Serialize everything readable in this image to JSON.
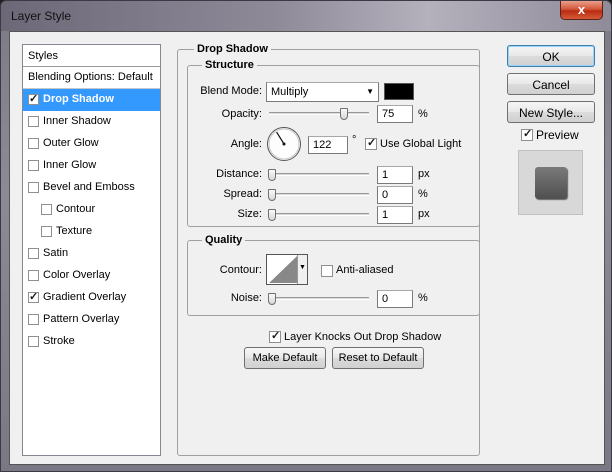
{
  "window": {
    "title": "Layer Style",
    "close_glyph": "x"
  },
  "styles_list": {
    "header": "Styles",
    "blending": "Blending Options: Default",
    "items": [
      {
        "label": "Drop Shadow",
        "checked": true,
        "selected": true,
        "indent": false
      },
      {
        "label": "Inner Shadow",
        "checked": false,
        "selected": false,
        "indent": false
      },
      {
        "label": "Outer Glow",
        "checked": false,
        "selected": false,
        "indent": false
      },
      {
        "label": "Inner Glow",
        "checked": false,
        "selected": false,
        "indent": false
      },
      {
        "label": "Bevel and Emboss",
        "checked": false,
        "selected": false,
        "indent": false
      },
      {
        "label": "Contour",
        "checked": false,
        "selected": false,
        "indent": true
      },
      {
        "label": "Texture",
        "checked": false,
        "selected": false,
        "indent": true
      },
      {
        "label": "Satin",
        "checked": false,
        "selected": false,
        "indent": false
      },
      {
        "label": "Color Overlay",
        "checked": false,
        "selected": false,
        "indent": false
      },
      {
        "label": "Gradient Overlay",
        "checked": true,
        "selected": false,
        "indent": false
      },
      {
        "label": "Pattern Overlay",
        "checked": false,
        "selected": false,
        "indent": false
      },
      {
        "label": "Stroke",
        "checked": false,
        "selected": false,
        "indent": false
      }
    ]
  },
  "drop_shadow": {
    "title": "Drop Shadow",
    "structure": {
      "title": "Structure",
      "blend_mode_label": "Blend Mode:",
      "blend_mode_value": "Multiply",
      "shadow_color": "#000000",
      "opacity_label": "Opacity:",
      "opacity_value": "75",
      "opacity_unit": "%",
      "opacity_level": 0.75,
      "angle_label": "Angle:",
      "angle_value": "122",
      "angle_unit": "°",
      "global_light_label": "Use Global Light",
      "global_light_checked": true,
      "distance_label": "Distance:",
      "distance_value": "1",
      "distance_unit": "px",
      "spread_label": "Spread:",
      "spread_value": "0",
      "spread_unit": "%",
      "size_label": "Size:",
      "size_value": "1",
      "size_unit": "px"
    },
    "quality": {
      "title": "Quality",
      "contour_label": "Contour:",
      "anti_aliased_label": "Anti-aliased",
      "anti_aliased_checked": false,
      "noise_label": "Noise:",
      "noise_value": "0",
      "noise_unit": "%"
    },
    "knockout_label": "Layer Knocks Out Drop Shadow",
    "knockout_checked": true,
    "make_default": "Make Default",
    "reset_default": "Reset to Default"
  },
  "actions": {
    "ok": "OK",
    "cancel": "Cancel",
    "new_style": "New Style...",
    "preview_label": "Preview",
    "preview_checked": true
  }
}
